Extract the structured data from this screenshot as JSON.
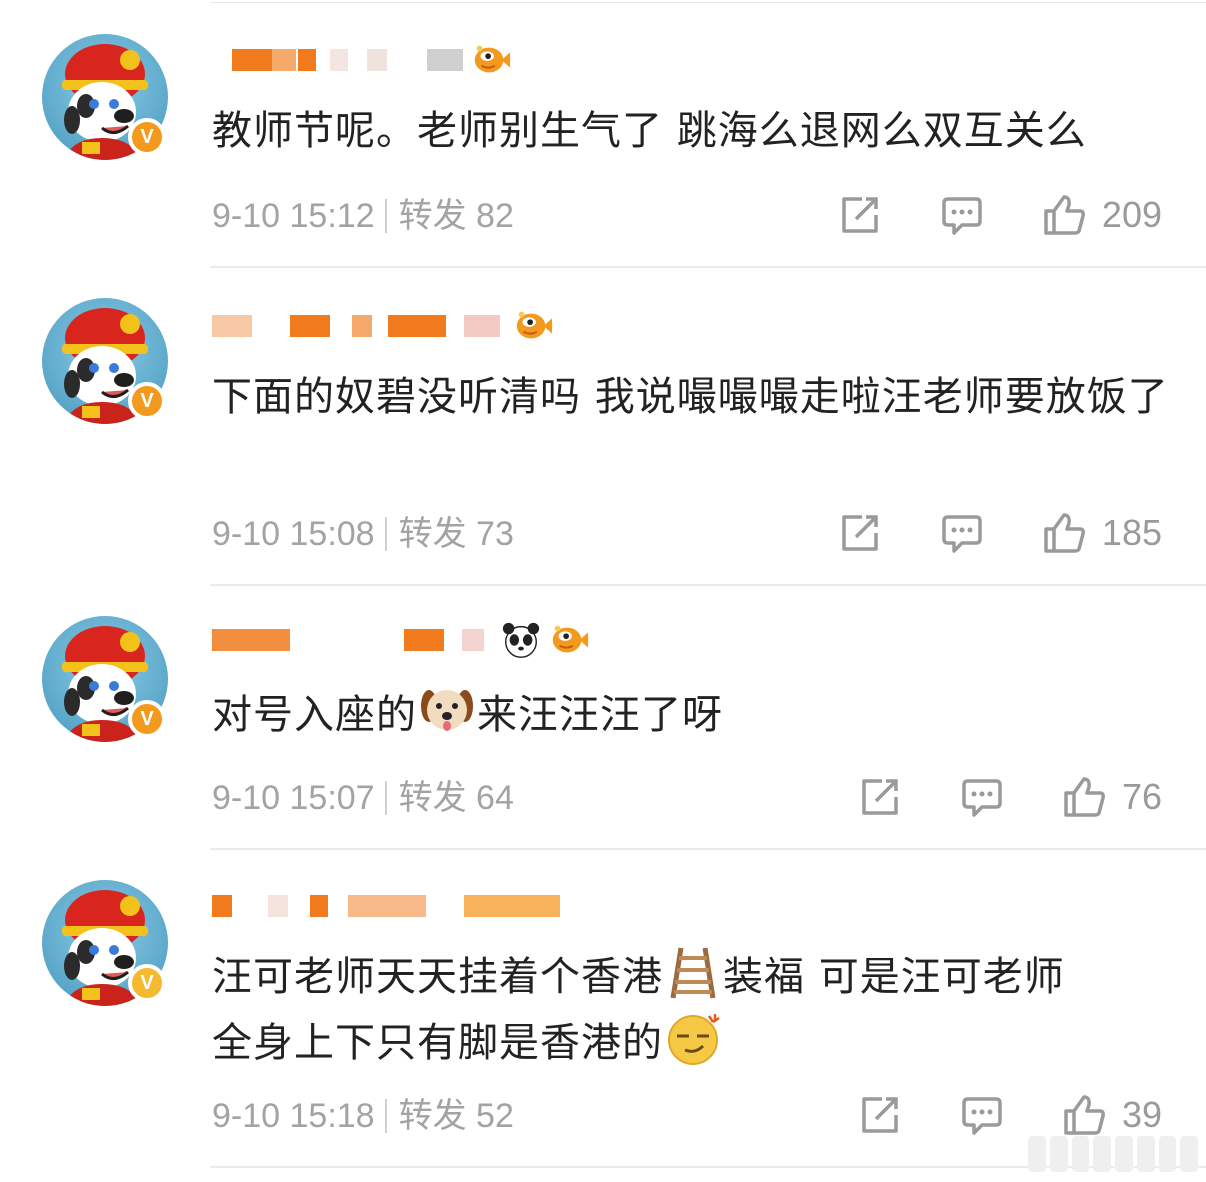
{
  "comments": [
    {
      "text": "教师节呢。老师别生气了 跳海么退网么双互关么",
      "date": "9-10 15:12",
      "repost_label": "转发",
      "repost_count": "82",
      "like_count": "209",
      "badge": "V"
    },
    {
      "text": "下面的奴碧没听清吗 我说嘬嘬嘬走啦汪老师要放饭了",
      "date": "9-10 15:08",
      "repost_label": "转发",
      "repost_count": "73",
      "like_count": "185",
      "badge": "V"
    },
    {
      "text_before": "对号入座的",
      "text_after": "来汪汪汪了呀",
      "date": "9-10 15:07",
      "repost_label": "转发",
      "repost_count": "64",
      "like_count": "76",
      "badge": "V"
    },
    {
      "text_line1_before": "汪可老师天天挂着个香港",
      "text_line1_after": "装福 可是汪可老师",
      "text_line2": "全身上下只有脚是香港的",
      "date": "9-10 15:18",
      "repost_label": "转发",
      "repost_count": "52",
      "like_count": "39",
      "badge": "V"
    }
  ],
  "colors": {
    "text": "#222222",
    "meta": "#a3a3a3",
    "badge_orange": "#f39a1e",
    "badge_yellow": "#f4b92e",
    "blur_orange": "#f07a1c"
  },
  "icons": [
    "share-icon",
    "comment-icon",
    "like-icon",
    "fish-emoji-icon",
    "panda-emoji-icon",
    "dog-emoji-icon",
    "ladder-emoji-icon",
    "smirk-emoji-icon"
  ]
}
